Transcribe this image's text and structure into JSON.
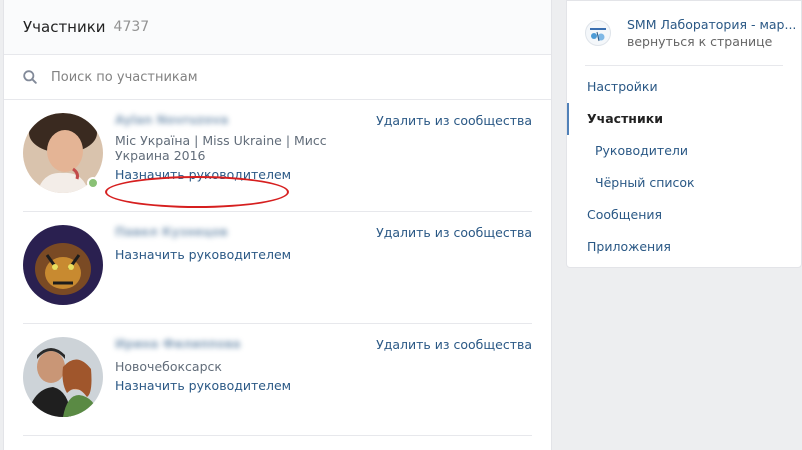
{
  "header": {
    "title": "Участники",
    "count": "4737"
  },
  "search": {
    "placeholder": "Поиск по участникам"
  },
  "members": [
    {
      "name": "Aylan Novruzova",
      "subtitle": "Miс Україна | Miss Ukraine | Мисс Украина 2016",
      "assign_label": "Назначить руководителем",
      "remove_label": "Удалить из сообщества",
      "online": true
    },
    {
      "name": "Павел Кузнецов",
      "subtitle": "",
      "assign_label": "Назначить руководителем",
      "remove_label": "Удалить из сообщества",
      "online": false
    },
    {
      "name": "Ирина Филиппова",
      "subtitle": "Новочебоксарск",
      "assign_label": "Назначить руководителем",
      "remove_label": "Удалить из сообщества",
      "online": false
    }
  ],
  "sidebar": {
    "group_title": "SMM Лаборатория - мар...",
    "group_sub": "вернуться к странице",
    "items": [
      {
        "label": "Настройки"
      },
      {
        "label": "Участники"
      },
      {
        "label": "Руководители"
      },
      {
        "label": "Чёрный список"
      },
      {
        "label": "Сообщения"
      },
      {
        "label": "Приложения"
      }
    ]
  },
  "colors": {
    "link": "#2a5885",
    "accent": "#5181b8",
    "online": "#8ac176",
    "highlight": "#d61f1f"
  }
}
